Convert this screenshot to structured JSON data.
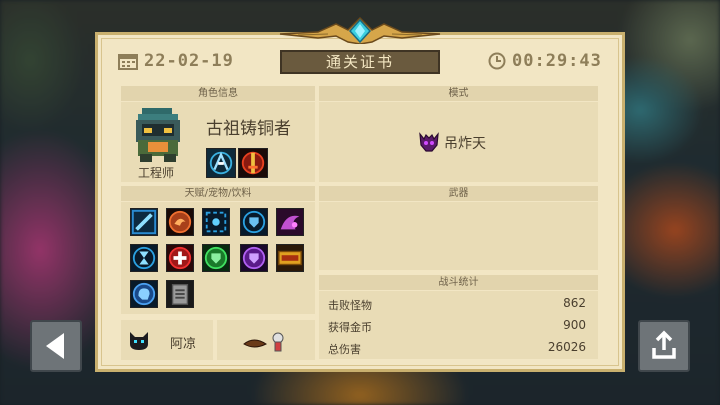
{
  "certificate": {
    "title": "通关证书",
    "date": "22-02-19",
    "time": "00:29:43"
  },
  "character": {
    "section_label": "角色信息",
    "name": "古祖铸铜者",
    "class": "工程师"
  },
  "mode": {
    "section_label": "模式",
    "name": "吊炸天"
  },
  "talents": {
    "section_label": "天赋/宠物/饮料",
    "icons": [
      "sword-slash-icon",
      "dragon-emblem-icon",
      "crosshair-frame-icon",
      "shield-badge-icon",
      "pink-swirl-icon",
      "hourglass-icon",
      "health-cross-icon",
      "green-shield-icon",
      "purple-shield-icon",
      "sale-tag-icon",
      "brain-icon",
      "clipboard-icon"
    ]
  },
  "weapons": {
    "section_label": "武器"
  },
  "stats": {
    "section_label": "战斗统计",
    "rows": [
      {
        "label": "击败怪物",
        "value": "862"
      },
      {
        "label": "获得金币",
        "value": "900"
      },
      {
        "label": "总伤害",
        "value": "26026"
      }
    ]
  },
  "pet": {
    "name": "阿凉"
  },
  "colors": {
    "paper": "#f2e6c4",
    "header": "#e2d4ad",
    "plate": "#6a5a3e",
    "text": "#4a3f2e"
  }
}
